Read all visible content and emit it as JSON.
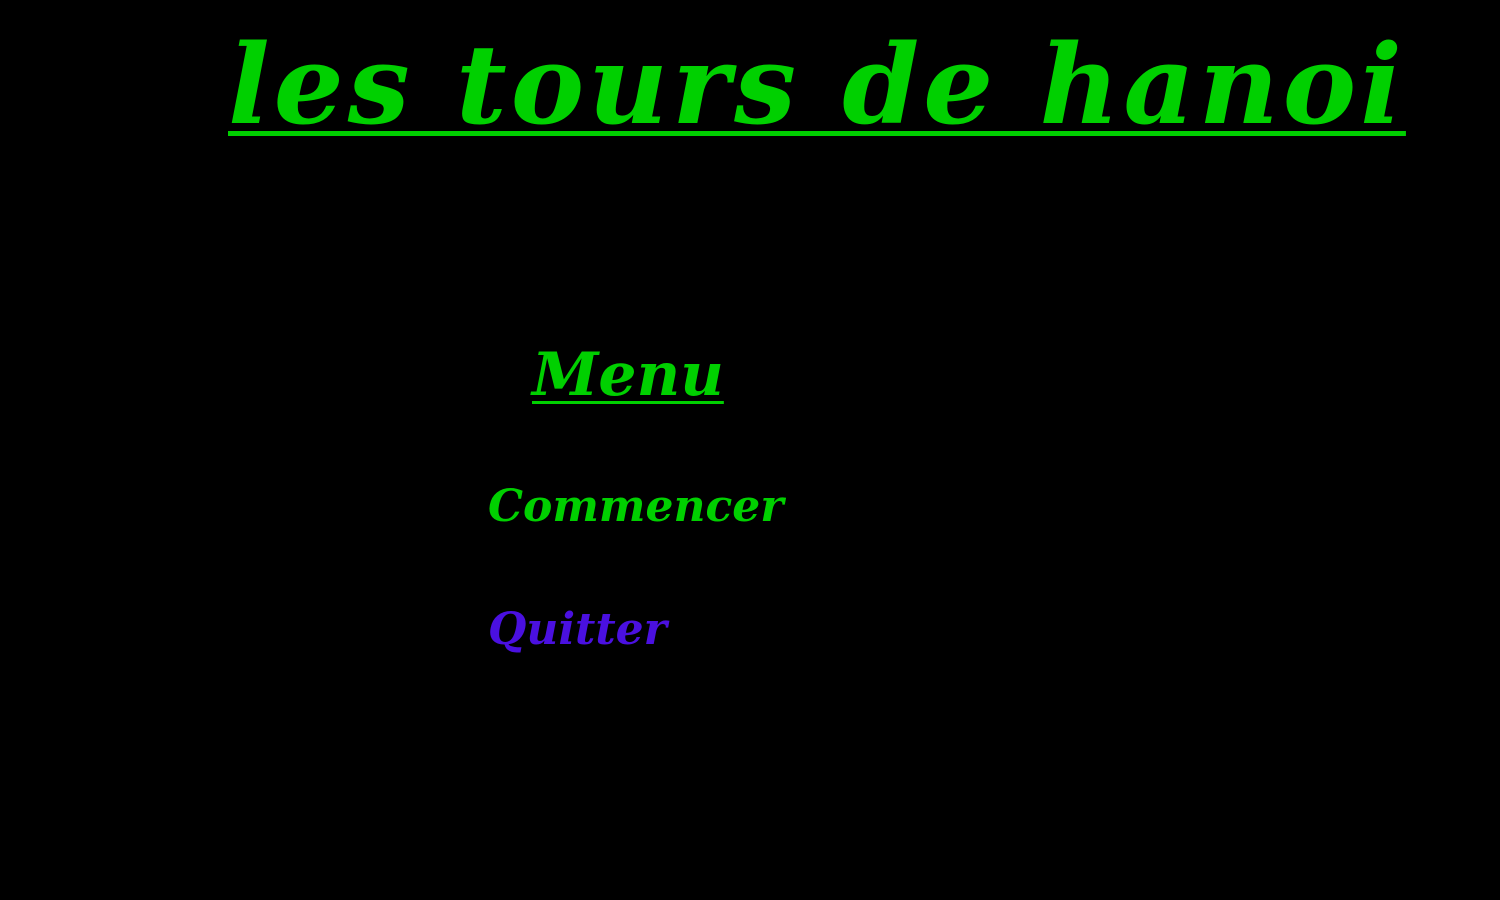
{
  "title": "les tours de hanoi",
  "menu": {
    "heading": "Menu",
    "options": [
      {
        "label": "Commencer",
        "selected": false
      },
      {
        "label": "Quitter",
        "selected": true
      }
    ]
  },
  "colors": {
    "background": "#000000",
    "text": "#00d000",
    "selected": "#4a10e0"
  }
}
